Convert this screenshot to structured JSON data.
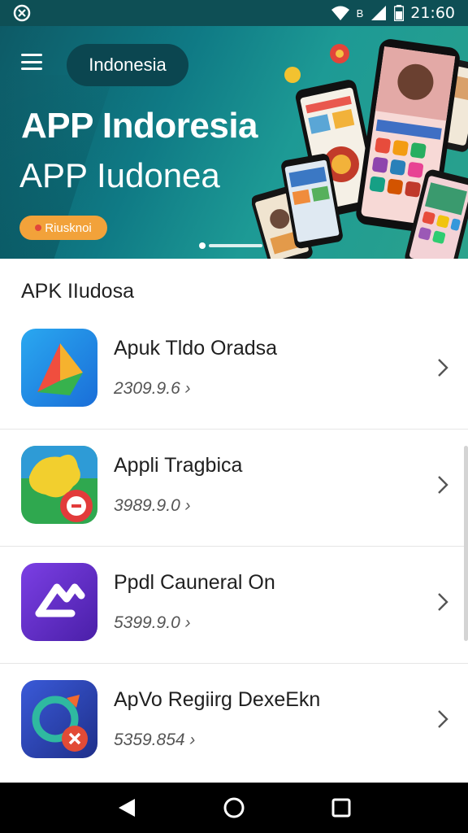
{
  "status_bar": {
    "time": "21:60",
    "notification_icon": "app-notification-icon",
    "network_label": "B"
  },
  "hero": {
    "country": "Indonesia",
    "title": "APP Indoresia",
    "subtitle": "APP Iudonea",
    "badge": "Riusknoi",
    "pager_active_index": 0,
    "colors": {
      "background": "#0f7a85",
      "badge": "#f2a23a",
      "pill": "#0b4650"
    }
  },
  "section": {
    "title": "APK IIudosa"
  },
  "apps": [
    {
      "name": "Apuk Tldo Oradsa",
      "meta": "2309.9.6",
      "icon": "triangle-logo-icon"
    },
    {
      "name": "Appli Tragbica",
      "meta": "3989.9.0",
      "icon": "green-map-icon"
    },
    {
      "name": "Ppdl Cauneral On",
      "meta": "5399.9.0",
      "icon": "purple-link-icon"
    },
    {
      "name": "ApVo Regiirg DexeEkn",
      "meta": "5359.854",
      "icon": "refresh-cross-icon"
    }
  ],
  "nav": {
    "back_icon": "back-icon",
    "home_icon": "home-icon",
    "recents_icon": "recents-icon"
  }
}
